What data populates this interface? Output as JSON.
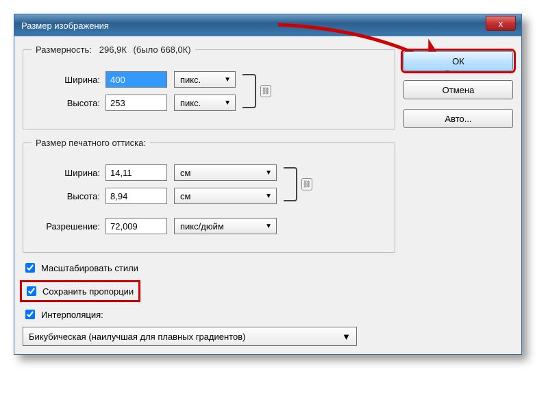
{
  "title": "Размер изображения",
  "dimensions": {
    "legend": "Размерность:",
    "summary_current": "296,9К",
    "summary_was": "(было 668,0К)",
    "width_label": "Ширина:",
    "width_value": "400",
    "width_unit": "пикс.",
    "height_label": "Высота:",
    "height_value": "253",
    "height_unit": "пикс."
  },
  "print": {
    "legend": "Размер печатного оттиска:",
    "width_label": "Ширина:",
    "width_value": "14,11",
    "width_unit": "см",
    "height_label": "Высота:",
    "height_value": "8,94",
    "height_unit": "см",
    "res_label": "Разрешение:",
    "res_value": "72,009",
    "res_unit": "пикс/дюйм"
  },
  "checks": {
    "scale_styles": "Масштабировать стили",
    "keep_ratio": "Сохранить пропорции",
    "interpolation": "Интерполяция:"
  },
  "interpolation_method": "Бикубическая (наилучшая для плавных градиентов)",
  "buttons": {
    "ok": "ОК",
    "cancel": "Отмена",
    "auto": "Авто..."
  },
  "icons": {
    "link": "⛓",
    "close": "x",
    "dropdown": "▼"
  }
}
